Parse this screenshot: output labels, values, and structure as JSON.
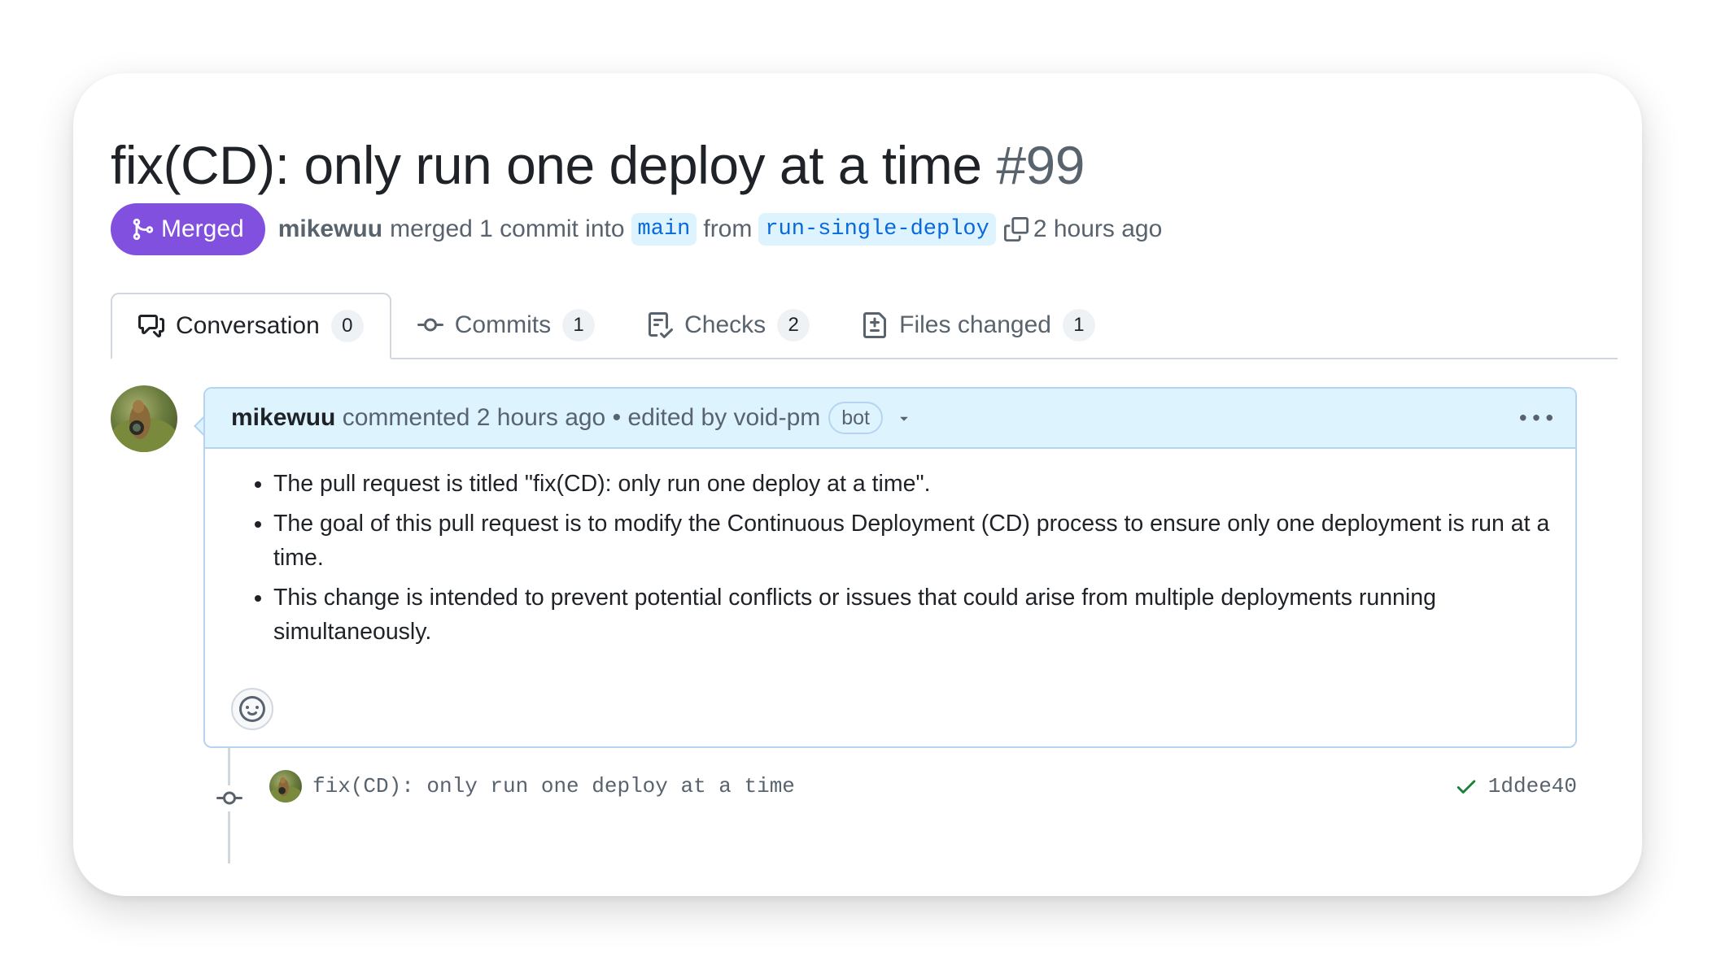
{
  "pull_request": {
    "title": "fix(CD): only run one deploy at a time",
    "number": "#99",
    "state_label": "Merged",
    "state_color": "#8250df",
    "author": "mikewuu",
    "action_text": "merged 1 commit into",
    "base_branch": "main",
    "from_text": "from",
    "head_branch": "run-single-deploy",
    "time": "2 hours ago"
  },
  "tabs": [
    {
      "label": "Conversation",
      "count": "0",
      "icon": "comment-discussion-icon",
      "active": true
    },
    {
      "label": "Commits",
      "count": "1",
      "icon": "git-commit-icon",
      "active": false
    },
    {
      "label": "Checks",
      "count": "2",
      "icon": "checklist-icon",
      "active": false
    },
    {
      "label": "Files changed",
      "count": "1",
      "icon": "file-diff-icon",
      "active": false
    }
  ],
  "comment": {
    "author": "mikewuu",
    "action": "commented 2 hours ago",
    "separator": "•",
    "edited_by": "edited by void-pm",
    "bot_label": "bot",
    "bullets": [
      "The pull request is titled \"fix(CD): only run one deploy at a time\".",
      "The goal of this pull request is to modify the Continuous Deployment (CD) process to ensure only one deployment is run at a time.",
      "This change is intended to prevent potential conflicts or issues that could arise from multiple deployments running simultaneously."
    ]
  },
  "commit": {
    "message": "fix(CD): only run one deploy at a time",
    "sha": "1ddee40",
    "status": "success",
    "status_color": "#1a7f37"
  },
  "colors": {
    "accent": "#0969da",
    "merged": "#8250df",
    "comment_header": "#ddf4ff",
    "success": "#1a7f37"
  }
}
